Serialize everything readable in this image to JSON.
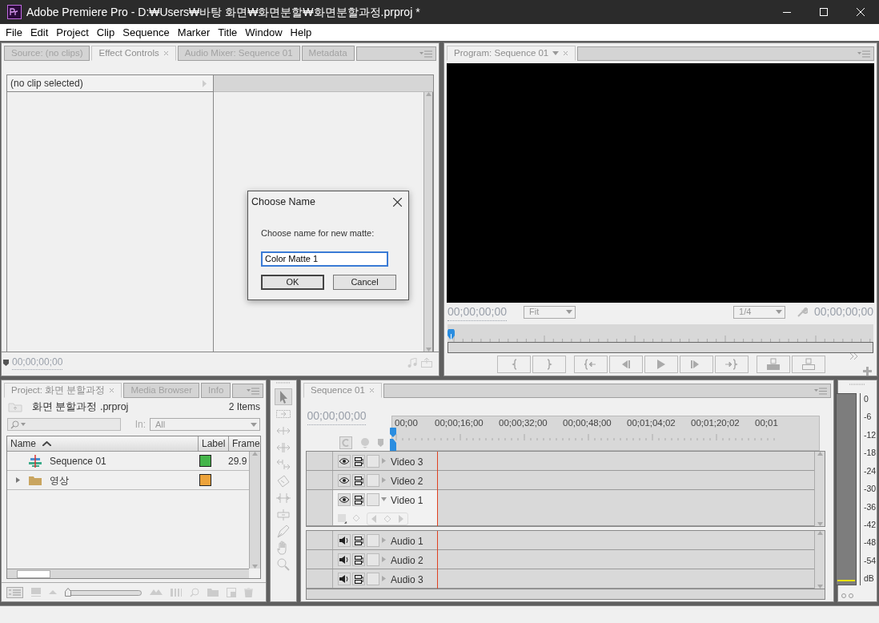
{
  "window": {
    "title": "Adobe Premiere Pro - D:₩Users₩바탕 화면₩화면분할₩화면분할과정.prproj *"
  },
  "menu": [
    "File",
    "Edit",
    "Project",
    "Clip",
    "Sequence",
    "Marker",
    "Title",
    "Window",
    "Help"
  ],
  "source_panel": {
    "tabs": [
      {
        "label": "Source: (no clips)",
        "selected": false
      },
      {
        "label": "Effect Controls",
        "selected": true
      },
      {
        "label": "Audio Mixer: Sequence 01",
        "selected": false
      },
      {
        "label": "Metadata",
        "selected": false
      }
    ],
    "clip_header": "(no clip selected)",
    "timecode": "00;00;00;00"
  },
  "program_panel": {
    "tabs": [
      {
        "label": "Program: Sequence 01",
        "selected": true
      }
    ],
    "timecode_current": "00;00;00;00",
    "zoom": "Fit",
    "resolution": "1/4",
    "timecode_duration": "00;00;00;00"
  },
  "project_panel": {
    "tabs": [
      {
        "label": "Project: 화면 분할과정",
        "selected": true
      },
      {
        "label": "Media Browser",
        "selected": false
      },
      {
        "label": "Info",
        "selected": false
      }
    ],
    "file": "화면 분할과정 .prproj",
    "item_count": "2 Items",
    "in_label": "In:",
    "in_value": "All",
    "zoom_slider": {
      "level": 0
    },
    "columns": [
      "Name",
      "Label",
      "Frame"
    ],
    "items": [
      {
        "kind": "sequence",
        "name": "Sequence 01",
        "color": "#44b54a",
        "frame_rate": "29.9"
      },
      {
        "kind": "bin",
        "name": "영상",
        "color": "#eda33a",
        "expanded": false
      }
    ]
  },
  "tools": [
    {
      "kind": "selection",
      "selected": true
    },
    {
      "kind": "track-select",
      "selected": false
    },
    {
      "kind": "ripple",
      "selected": false
    },
    {
      "kind": "rolling",
      "selected": false
    },
    {
      "kind": "rate-stretch",
      "selected": false
    },
    {
      "kind": "razor",
      "selected": false
    },
    {
      "kind": "slip",
      "selected": false
    },
    {
      "kind": "slide",
      "selected": false
    },
    {
      "kind": "pen",
      "selected": false
    },
    {
      "kind": "hand",
      "selected": false
    },
    {
      "kind": "zoom",
      "selected": false
    }
  ],
  "timeline": {
    "tabs": [
      {
        "label": "Sequence 01",
        "selected": true
      }
    ],
    "timecode": "00;00;00;00",
    "ruler": [
      "00;00",
      "00;00;16;00",
      "00;00;32;00",
      "00;00;48;00",
      "00;01;04;02",
      "00;01;20;02",
      "00;01"
    ],
    "tracks": [
      {
        "kind": "video",
        "name": "Video 3",
        "expanded": false
      },
      {
        "kind": "video",
        "name": "Video 2",
        "expanded": false
      },
      {
        "kind": "video",
        "name": "Video 1",
        "expanded": true
      },
      {
        "kind": "audio",
        "name": "Audio 1",
        "expanded": false
      },
      {
        "kind": "audio",
        "name": "Audio 2",
        "expanded": false
      },
      {
        "kind": "audio",
        "name": "Audio 3",
        "expanded": false
      }
    ]
  },
  "audio_meter": {
    "scale": [
      "0",
      "-6",
      "-12",
      "-18",
      "-24",
      "-30",
      "-36",
      "-42",
      "-48",
      "-54",
      "dB"
    ]
  },
  "dialog": {
    "title": "Choose Name",
    "prompt": "Choose name for new matte:",
    "value": "Color Matte 1",
    "buttons": [
      "OK",
      "Cancel"
    ]
  }
}
